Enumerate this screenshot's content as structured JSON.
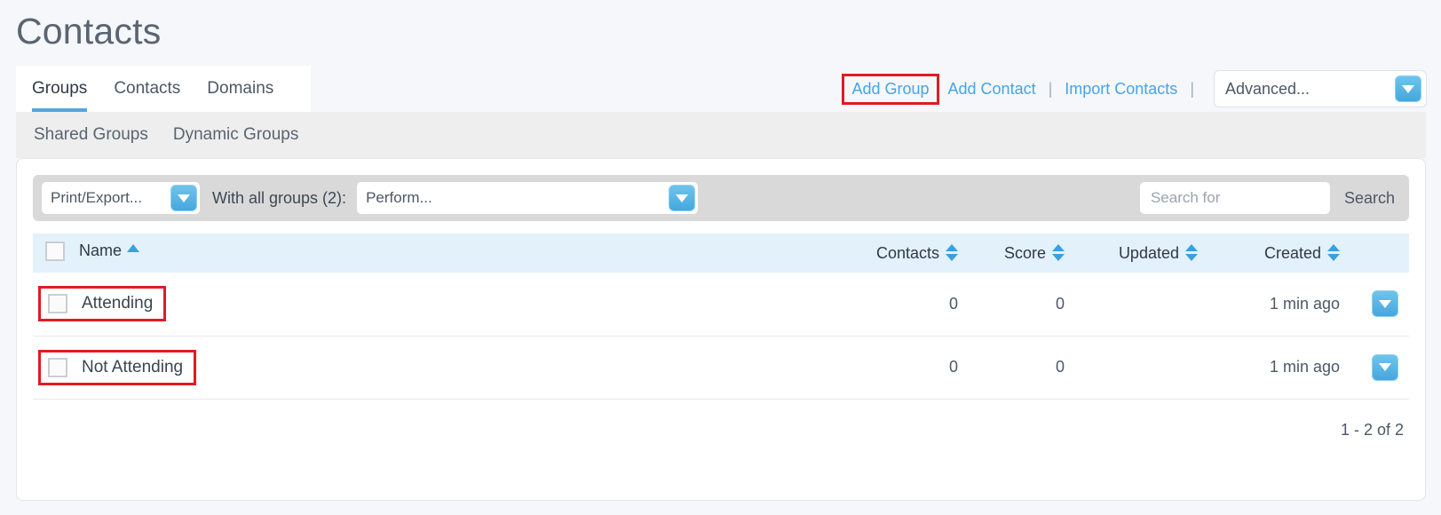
{
  "page": {
    "title": "Contacts"
  },
  "primary_tabs": [
    {
      "label": "Groups",
      "active": true
    },
    {
      "label": "Contacts",
      "active": false
    },
    {
      "label": "Domains",
      "active": false
    }
  ],
  "header_actions": {
    "add_group": "Add Group",
    "add_contact": "Add Contact",
    "import_contacts": "Import Contacts",
    "separator": "|",
    "advanced_select": "Advanced..."
  },
  "secondary_tabs": [
    {
      "label": "Shared Groups"
    },
    {
      "label": "Dynamic Groups"
    }
  ],
  "toolbar": {
    "print_export": "Print/Export...",
    "with_all_groups_label": "With all groups (2):",
    "perform": "Perform...",
    "search_placeholder": "Search for",
    "search_value": "",
    "search_button": "Search"
  },
  "table": {
    "columns": {
      "name": "Name",
      "contacts": "Contacts",
      "score": "Score",
      "updated": "Updated",
      "created": "Created"
    },
    "rows": [
      {
        "name": "Attending",
        "contacts": "0",
        "score": "0",
        "updated": "",
        "created": "1 min ago"
      },
      {
        "name": "Not Attending",
        "contacts": "0",
        "score": "0",
        "updated": "",
        "created": "1 min ago"
      }
    ]
  },
  "pagination": {
    "summary": "1 - 2 of 2"
  },
  "colors": {
    "accent_blue": "#4aa3e3",
    "tab_underline": "#52a8e0",
    "highlight_red": "#e01b22",
    "table_header_bg": "#e3f1fb",
    "toolbar_bg": "#d9d9d9",
    "page_bg": "#f5f7fa"
  }
}
